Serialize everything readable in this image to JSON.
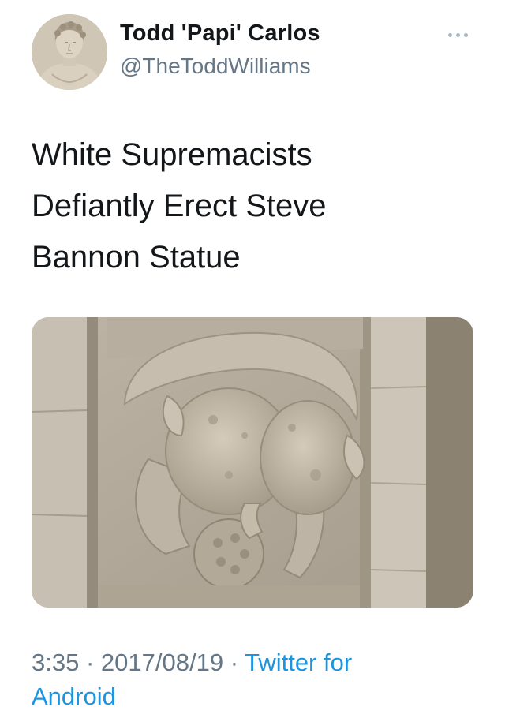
{
  "author": {
    "display_name": "Todd 'Papi' Carlos",
    "handle": "@TheToddWilliams",
    "avatar_icon": "statue-avatar"
  },
  "tweet": {
    "text_lines": [
      "White Supremacists",
      "Defiantly Erect Steve",
      "Bannon Statue"
    ],
    "media_description_icon": "stone-gargoyle-photo"
  },
  "meta": {
    "time": "3:35",
    "separator": "·",
    "date": "2017/08/19",
    "source_line1": "Twitter for",
    "source_line2": "Android"
  },
  "menu": {
    "more_icon": "more-options-icon"
  },
  "colors": {
    "text": "#14171a",
    "secondary": "#657786",
    "link": "#1b95e0",
    "background": "#ffffff"
  }
}
